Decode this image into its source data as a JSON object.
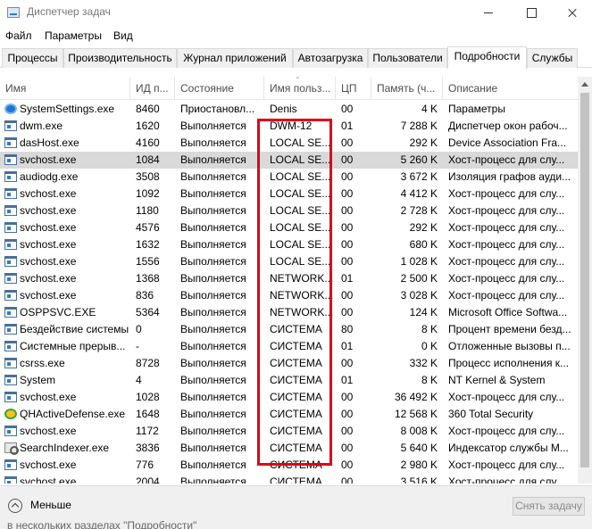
{
  "window": {
    "title": "Диспетчер задач"
  },
  "menu": [
    "Файл",
    "Параметры",
    "Вид"
  ],
  "tabs": [
    "Процессы",
    "Производительность",
    "Журнал приложений",
    "Автозагрузка",
    "Пользователи",
    "Подробности",
    "Службы"
  ],
  "active_tab": "Подробности",
  "columns": [
    "Имя",
    "ИД п...",
    "Состояние",
    "Имя польз...",
    "ЦП",
    "Память (ч...",
    "Описание"
  ],
  "rows": [
    {
      "name": "SystemSettings.exe",
      "icon": "gear-icon",
      "pid": "8460",
      "status": "Приостановл...",
      "user": "Denis",
      "cpu": "00",
      "memory": "4 K",
      "description": "Параметры"
    },
    {
      "name": "dwm.exe",
      "icon": "window-icon",
      "pid": "1620",
      "status": "Выполняется",
      "user": "DWM-12",
      "cpu": "01",
      "memory": "7 288 K",
      "description": "Диспетчер окон рабоч..."
    },
    {
      "name": "dasHost.exe",
      "icon": "window-icon",
      "pid": "4160",
      "status": "Выполняется",
      "user": "LOCAL SE...",
      "cpu": "00",
      "memory": "292 K",
      "description": "Device Association Fra..."
    },
    {
      "name": "svchost.exe",
      "icon": "window-icon",
      "pid": "1084",
      "status": "Выполняется",
      "user": "LOCAL SE...",
      "cpu": "00",
      "memory": "5 260 K",
      "description": "Хост-процесс для слу...",
      "selected": true
    },
    {
      "name": "audiodg.exe",
      "icon": "window-icon",
      "pid": "3508",
      "status": "Выполняется",
      "user": "LOCAL SE...",
      "cpu": "00",
      "memory": "3 672 K",
      "description": "Изоляция графов ауди..."
    },
    {
      "name": "svchost.exe",
      "icon": "window-icon",
      "pid": "1092",
      "status": "Выполняется",
      "user": "LOCAL SE...",
      "cpu": "00",
      "memory": "4 412 K",
      "description": "Хост-процесс для слу..."
    },
    {
      "name": "svchost.exe",
      "icon": "window-icon",
      "pid": "1180",
      "status": "Выполняется",
      "user": "LOCAL SE...",
      "cpu": "00",
      "memory": "2 728 K",
      "description": "Хост-процесс для слу..."
    },
    {
      "name": "svchost.exe",
      "icon": "window-icon",
      "pid": "4576",
      "status": "Выполняется",
      "user": "LOCAL SE...",
      "cpu": "00",
      "memory": "292 K",
      "description": "Хост-процесс для слу..."
    },
    {
      "name": "svchost.exe",
      "icon": "window-icon",
      "pid": "1632",
      "status": "Выполняется",
      "user": "LOCAL SE...",
      "cpu": "00",
      "memory": "680 K",
      "description": "Хост-процесс для слу..."
    },
    {
      "name": "svchost.exe",
      "icon": "window-icon",
      "pid": "1556",
      "status": "Выполняется",
      "user": "LOCAL SE...",
      "cpu": "00",
      "memory": "1 028 K",
      "description": "Хост-процесс для слу..."
    },
    {
      "name": "svchost.exe",
      "icon": "window-icon",
      "pid": "1368",
      "status": "Выполняется",
      "user": "NETWORK...",
      "cpu": "01",
      "memory": "2 500 K",
      "description": "Хост-процесс для слу..."
    },
    {
      "name": "svchost.exe",
      "icon": "window-icon",
      "pid": "836",
      "status": "Выполняется",
      "user": "NETWORK...",
      "cpu": "00",
      "memory": "3 028 K",
      "description": "Хост-процесс для слу..."
    },
    {
      "name": "OSPPSVC.EXE",
      "icon": "window-icon",
      "pid": "5364",
      "status": "Выполняется",
      "user": "NETWORK...",
      "cpu": "00",
      "memory": "124 K",
      "description": "Microsoft Office Softwa..."
    },
    {
      "name": "Бездействие системы",
      "icon": "window-icon",
      "pid": "0",
      "status": "Выполняется",
      "user": "СИСТЕМА",
      "cpu": "80",
      "memory": "8 K",
      "description": "Процент времени безд..."
    },
    {
      "name": "Системные прерыв...",
      "icon": "window-icon",
      "pid": "-",
      "status": "Выполняется",
      "user": "СИСТЕМА",
      "cpu": "01",
      "memory": "0 K",
      "description": "Отложенные вызовы п..."
    },
    {
      "name": "csrss.exe",
      "icon": "window-icon",
      "pid": "8728",
      "status": "Выполняется",
      "user": "СИСТЕМА",
      "cpu": "00",
      "memory": "332 K",
      "description": "Процесс исполнения к..."
    },
    {
      "name": "System",
      "icon": "window-icon",
      "pid": "4",
      "status": "Выполняется",
      "user": "СИСТЕМА",
      "cpu": "01",
      "memory": "8 K",
      "description": "NT Kernel & System"
    },
    {
      "name": "svchost.exe",
      "icon": "window-icon",
      "pid": "1028",
      "status": "Выполняется",
      "user": "СИСТЕМА",
      "cpu": "00",
      "memory": "36 492 K",
      "description": "Хост-процесс для слу..."
    },
    {
      "name": "QHActiveDefense.exe",
      "icon": "shield-icon",
      "pid": "1648",
      "status": "Выполняется",
      "user": "СИСТЕМА",
      "cpu": "00",
      "memory": "12 568 K",
      "description": "360 Total Security"
    },
    {
      "name": "svchost.exe",
      "icon": "window-icon",
      "pid": "1172",
      "status": "Выполняется",
      "user": "СИСТЕМА",
      "cpu": "00",
      "memory": "8 008 K",
      "description": "Хост-процесс для слу..."
    },
    {
      "name": "SearchIndexer.exe",
      "icon": "search-icon",
      "pid": "3836",
      "status": "Выполняется",
      "user": "СИСТЕМА",
      "cpu": "00",
      "memory": "5 640 K",
      "description": "Индексатор службы M..."
    },
    {
      "name": "svchost.exe",
      "icon": "window-icon",
      "pid": "776",
      "status": "Выполняется",
      "user": "СИСТЕМА",
      "cpu": "00",
      "memory": "2 980 K",
      "description": "Хост-процесс для слу..."
    },
    {
      "name": "svchost.exe",
      "icon": "window-icon",
      "pid": "2004",
      "status": "Выполняется",
      "user": "СИСТЕМА",
      "cpu": "00",
      "memory": "3 516 K",
      "description": "Хост-процесс для слу..."
    }
  ],
  "footer": {
    "less_label": "Меньше",
    "end_task_label": "Снять задачу",
    "faded_text": "в нескольких разделах \"Подробности\""
  },
  "colors": {
    "highlight": "#e2001a",
    "selected_row": "#d9d9d9"
  }
}
